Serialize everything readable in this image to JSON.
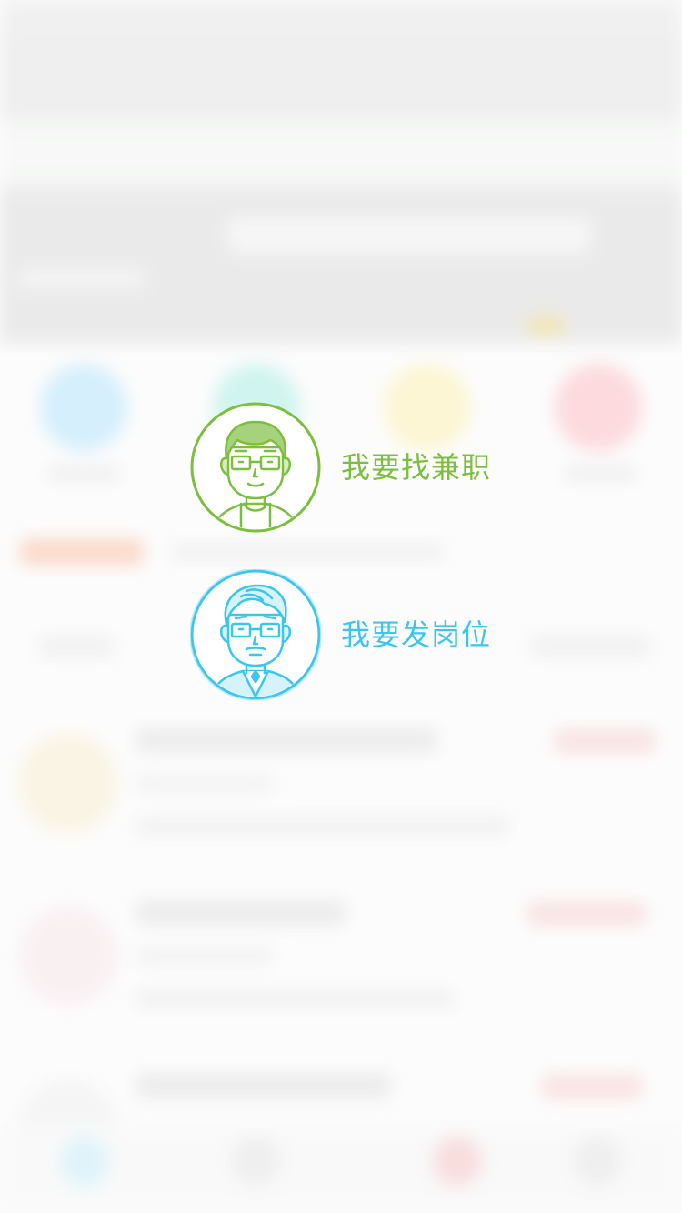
{
  "overlay": {
    "options": [
      {
        "label": "我要找兼职",
        "color": "#7cbf3f",
        "avatar_icon": "young-man-with-glasses-icon"
      },
      {
        "label": "我要发岗位",
        "color": "#3cc6ec",
        "avatar_icon": "older-man-with-glasses-and-tie-icon"
      }
    ]
  },
  "background": {
    "blurred": true,
    "category_colors": [
      "#bfe6fb",
      "#b7efe6",
      "#fbf1bd",
      "#fbc7cb"
    ],
    "accent_colors": {
      "notice": "#f7c7b0",
      "banner_highlight": "#efd98b"
    }
  }
}
